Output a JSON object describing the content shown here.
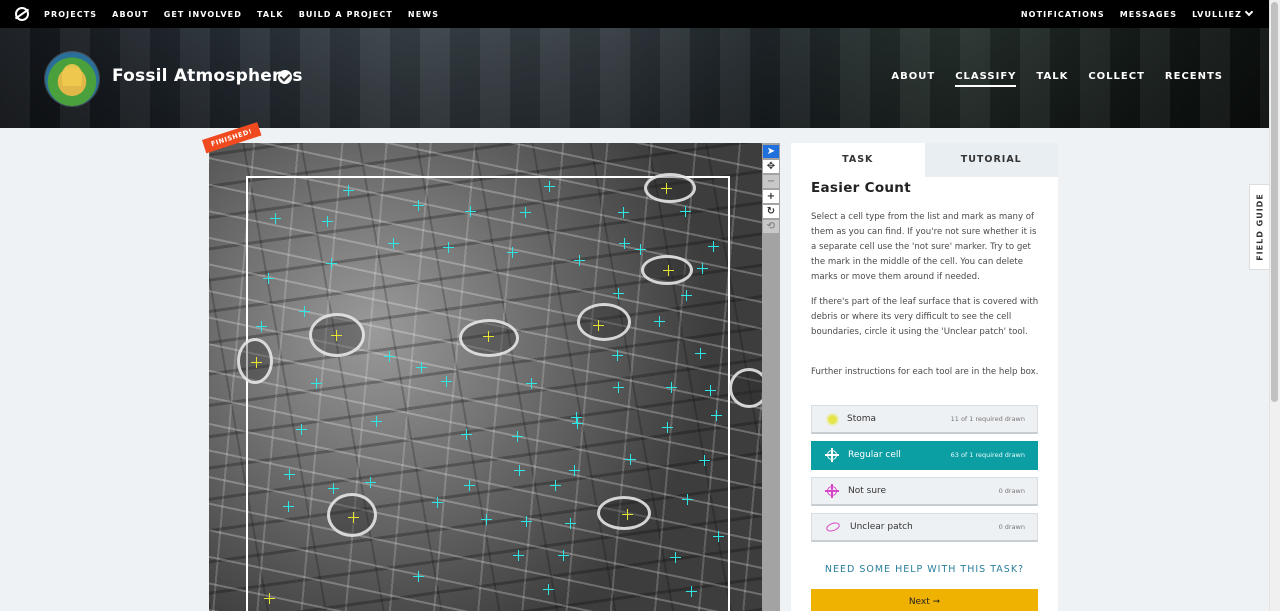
{
  "topnav": {
    "left": [
      "PROJECTS",
      "ABOUT",
      "GET INVOLVED",
      "TALK",
      "BUILD A PROJECT",
      "NEWS"
    ],
    "right": [
      "NOTIFICATIONS",
      "MESSAGES",
      "LVULLIEZ"
    ]
  },
  "project": {
    "title": "Fossil Atmospheres",
    "nav": [
      "ABOUT",
      "CLASSIFY",
      "TALK",
      "COLLECT",
      "RECENTS"
    ],
    "active_nav": "CLASSIFY"
  },
  "subject": {
    "ribbon": "FINISHED!"
  },
  "task": {
    "tabs": [
      "TASK",
      "TUTORIAL"
    ],
    "title": "Easier Count",
    "instructions": [
      "Select a cell type from the list and mark as many of them as you can find. If you're not sure whether it is a separate cell use the 'not sure' marker. Try to get the mark in the middle of the cell. You can delete marks or move them around if needed.",
      "If there's part of the leaf surface that is covered with debris or where its very difficult to see the cell boundaries, circle it using the 'Unclear patch' tool.",
      "Further instructions for each tool are in the help box."
    ],
    "tools": [
      {
        "label": "Stoma",
        "count": "11 of 1 required drawn",
        "icon": "stoma-dot-icon",
        "color": "#e5e54a"
      },
      {
        "label": "Regular cell",
        "count": "63 of 1 required drawn",
        "icon": "crosshair-icon",
        "color": "#0b9ea3"
      },
      {
        "label": "Not sure",
        "count": "0 drawn",
        "icon": "crosshair-icon",
        "color": "#d946c8"
      },
      {
        "label": "Unclear patch",
        "count": "0 drawn",
        "icon": "ellipse-icon",
        "color": "#d946c8"
      }
    ],
    "help": "NEED SOME HELP WITH THIS TASK?",
    "next": "Next ➞"
  },
  "field_guide": "FIELD GUIDE",
  "toolbar_icons": [
    "pointer-icon",
    "move-icon",
    "zoom-out-icon",
    "zoom-in-icon",
    "rotate-icon",
    "reset-icon"
  ]
}
